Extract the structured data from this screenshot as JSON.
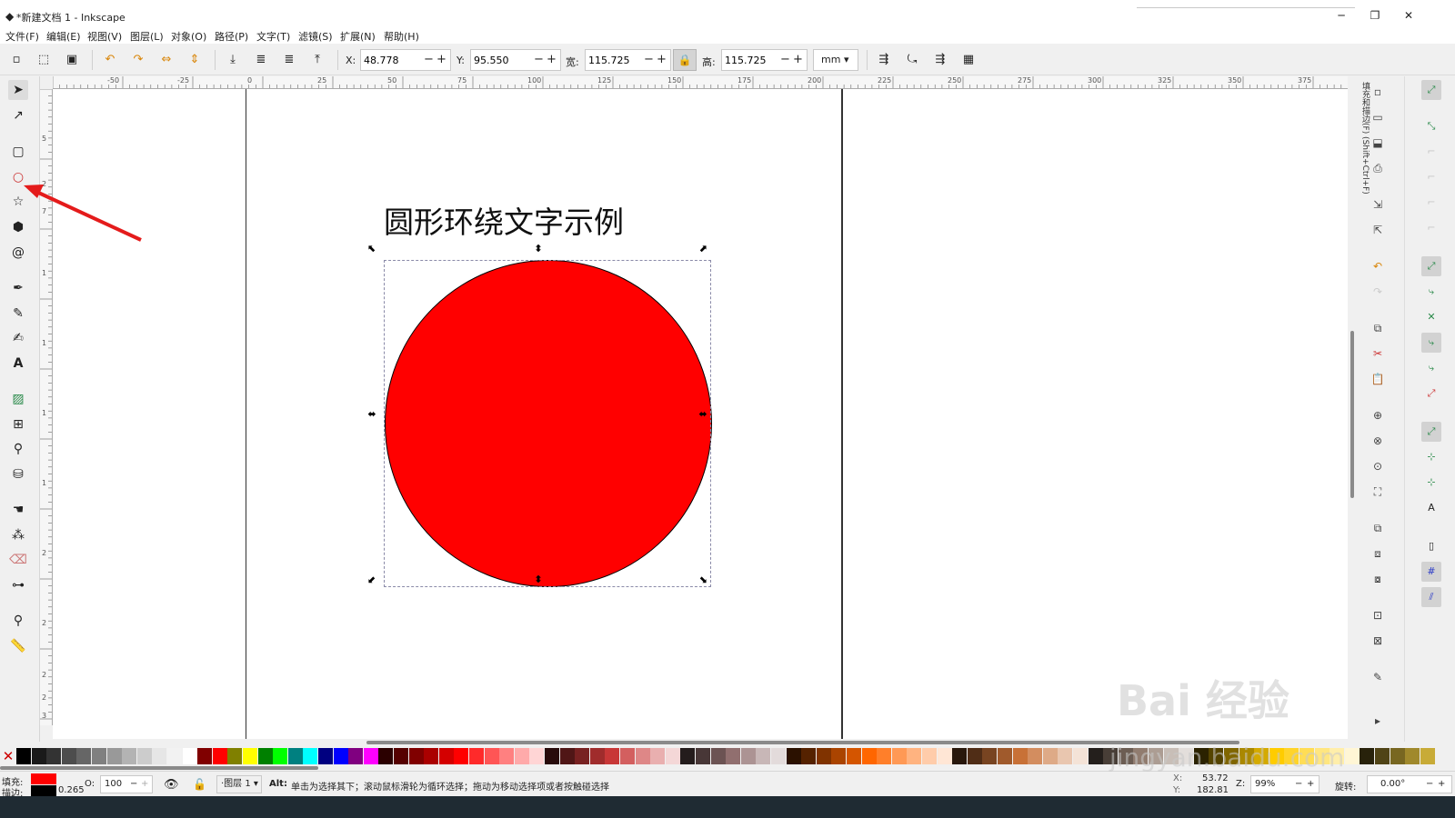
{
  "window": {
    "title": "*新建文档 1 - Inkscape",
    "controls": {
      "minimize": "─",
      "restore": "❐",
      "close": "✕"
    }
  },
  "menu": [
    "文件(F)",
    "编辑(E)",
    "视图(V)",
    "图层(L)",
    "对象(O)",
    "路径(P)",
    "文字(T)",
    "滤镜(S)",
    "扩展(N)",
    "帮助(H)"
  ],
  "controls": {
    "x_label": "X:",
    "x_value": "48.778",
    "y_label": "Y:",
    "y_value": "95.550",
    "w_label": "宽:",
    "w_value": "115.725",
    "h_label": "高:",
    "h_value": "115.725",
    "unit": "mm",
    "minus": "−",
    "plus": "+"
  },
  "ruler_top_labels": [
    "-50",
    "-25",
    "0",
    "25",
    "50",
    "75",
    "100",
    "125",
    "150",
    "175",
    "200",
    "225",
    "250",
    "275",
    "300",
    "325",
    "350",
    "375"
  ],
  "ruler_left_labels": [
    "5",
    "2",
    "7",
    "1",
    "1",
    "1",
    "1",
    "2",
    "2",
    "2",
    "2",
    "3"
  ],
  "canvas": {
    "text": "圆形环绕文字示例",
    "circle_fill": "#ff0000",
    "circle_stroke": "#000000"
  },
  "commands_panel_tab": "填充和描边(F) (Shift+Ctrl+F)",
  "palette": {
    "colors": [
      "#000000",
      "#1a1a1a",
      "#333333",
      "#4d4d4d",
      "#666666",
      "#808080",
      "#999999",
      "#b3b3b3",
      "#cccccc",
      "#e6e6e6",
      "#f2f2f2",
      "#ffffff",
      "#800000",
      "#ff0000",
      "#808000",
      "#ffff00",
      "#008000",
      "#00ff00",
      "#008080",
      "#00ffff",
      "#000080",
      "#0000ff",
      "#800080",
      "#ff00ff",
      "#2b0000",
      "#550000",
      "#800000",
      "#aa0000",
      "#d40000",
      "#ff0000",
      "#ff2a2a",
      "#ff5555",
      "#ff8080",
      "#ffaaaa",
      "#ffd5d5",
      "#280b0b",
      "#501616",
      "#782121",
      "#a02c2c",
      "#c83737",
      "#d35f5f",
      "#de8787",
      "#e9afaf",
      "#f4d7d7",
      "#241c1c",
      "#483737",
      "#6c5353",
      "#916f6f",
      "#ac9393",
      "#c8b7b7",
      "#e3dbdb",
      "#2b1100",
      "#552200",
      "#803300",
      "#aa4400",
      "#d45500",
      "#ff6600",
      "#ff7f2a",
      "#ff9955",
      "#ffb380",
      "#ffccaa",
      "#ffe6d5",
      "#28170b",
      "#502d16",
      "#784421",
      "#a05a2c",
      "#c87137",
      "#d38d5f",
      "#deaa87",
      "#e9c6af",
      "#f4e3d7",
      "#241f1c",
      "#483e37",
      "#6c5d53",
      "#917c6f",
      "#ac9d93",
      "#c8beb7",
      "#e3dedb",
      "#2b2200",
      "#554400",
      "#806600",
      "#aa8800",
      "#d4aa00",
      "#ffcc00",
      "#ffd42a",
      "#ffdd55",
      "#ffe680",
      "#ffeeaa",
      "#fff6d5",
      "#28220b",
      "#504416",
      "#786721",
      "#a0892c",
      "#c8ab37"
    ],
    "none_symbol": "✕"
  },
  "status": {
    "fill_label": "填充:",
    "stroke_label": "描边:",
    "stroke_width": "0.265",
    "opacity_label": "O:",
    "opacity_value": "100",
    "layer": "·图层 1",
    "hint_key": "Alt:",
    "hint_text": "单击为选择其下；滚动鼠标滑轮为循环选择；拖动为移动选择项或者按触碰选择",
    "x_label": "X:",
    "x_value": "53.72",
    "y_label": "Y:",
    "y_value": "182.81",
    "zoom_label": "Z:",
    "zoom_value": "99%",
    "rotate_label": "旋转:",
    "rotate_value": "0.00°"
  },
  "watermark": {
    "brand": "Bai  经验",
    "url": "jingyan.baidu.com"
  },
  "annotation_color": "#e41b1b"
}
